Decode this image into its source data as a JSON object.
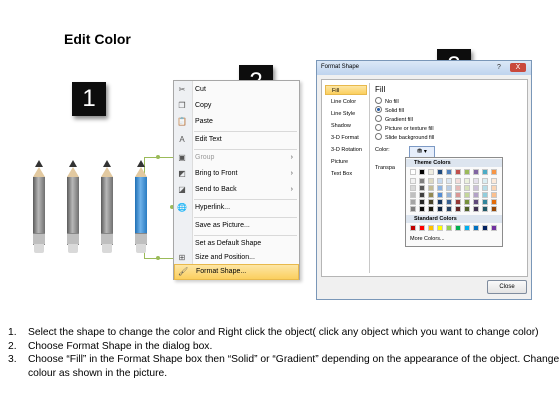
{
  "title": "Edit Color",
  "badges": [
    "1",
    "2",
    "3"
  ],
  "pencils": [
    {
      "color": "gray"
    },
    {
      "color": "gray"
    },
    {
      "color": "gray"
    },
    {
      "color": "blue",
      "hex": "#3a8fd6"
    }
  ],
  "context_menu": {
    "items": [
      {
        "label": "Cut",
        "icon": "scissors-icon",
        "enabled": true
      },
      {
        "label": "Copy",
        "icon": "copy-icon",
        "enabled": true
      },
      {
        "label": "Paste",
        "icon": "paste-icon",
        "enabled": true
      },
      {
        "label": "Edit Text",
        "icon": "edit-text-icon",
        "enabled": true
      },
      {
        "label": "Group",
        "icon": "group-icon",
        "enabled": false,
        "submenu": true
      },
      {
        "label": "Bring to Front",
        "icon": "bring-front-icon",
        "enabled": true,
        "submenu": true
      },
      {
        "label": "Send to Back",
        "icon": "send-back-icon",
        "enabled": true,
        "submenu": true
      },
      {
        "label": "Hyperlink...",
        "icon": "hyperlink-icon",
        "enabled": true
      },
      {
        "label": "Save as Picture...",
        "enabled": true
      },
      {
        "label": "Set as Default Shape",
        "enabled": true
      },
      {
        "label": "Size and Position...",
        "icon": "size-position-icon",
        "enabled": true
      },
      {
        "label": "Format Shape...",
        "icon": "format-shape-icon",
        "enabled": true,
        "highlighted": true
      }
    ]
  },
  "dialog": {
    "title": "Format Shape",
    "help": "?",
    "close_x": "X",
    "nav": [
      "Fill",
      "Line Color",
      "Line Style",
      "Shadow",
      "3-D Format",
      "3-D Rotation",
      "Picture",
      "Text Box"
    ],
    "section_title": "Fill",
    "options": [
      {
        "label": "No fill",
        "checked": false
      },
      {
        "label": "Solid fill",
        "checked": true
      },
      {
        "label": "Gradient fill",
        "checked": false
      },
      {
        "label": "Picture or texture fill",
        "checked": false
      },
      {
        "label": "Slide background fill",
        "checked": false
      }
    ],
    "color_label": "Color:",
    "transparency_label": "Transpa",
    "close_button": "Close",
    "picker": {
      "theme_header": "Theme Colors",
      "standard_header": "Standard Colors",
      "more_colors": "More Colors...",
      "theme_top": [
        "#ffffff",
        "#000000",
        "#eeece1",
        "#1f497d",
        "#4f81bd",
        "#c0504d",
        "#9bbb59",
        "#8064a2",
        "#4bacc6",
        "#f79646"
      ],
      "theme_shades": [
        [
          "#f2f2f2",
          "#7f7f7f",
          "#ddd9c3",
          "#c6d9f0",
          "#dbe5f1",
          "#f2dcdb",
          "#ebf1dd",
          "#e5e0ec",
          "#dbeef3",
          "#fdeada"
        ],
        [
          "#d8d8d8",
          "#595959",
          "#c4bd97",
          "#8db3e2",
          "#b8cce4",
          "#e5b9b7",
          "#d7e3bc",
          "#ccc1d9",
          "#b7dde8",
          "#fbd5b5"
        ],
        [
          "#bfbfbf",
          "#3f3f3f",
          "#938953",
          "#548dd4",
          "#95b3d7",
          "#d99694",
          "#c3d69b",
          "#b2a2c7",
          "#92cddc",
          "#fac08f"
        ],
        [
          "#a5a5a5",
          "#262626",
          "#494429",
          "#17365d",
          "#366092",
          "#953734",
          "#76923c",
          "#5f497a",
          "#31859b",
          "#e36c09"
        ],
        [
          "#7f7f7f",
          "#0c0c0c",
          "#1d1b10",
          "#0f243e",
          "#244061",
          "#632423",
          "#4f6128",
          "#3f3151",
          "#205867",
          "#974806"
        ]
      ],
      "standard": [
        "#c00000",
        "#ff0000",
        "#ffc000",
        "#ffff00",
        "#92d050",
        "#00b050",
        "#00b0f0",
        "#0070c0",
        "#002060",
        "#7030a0"
      ]
    }
  },
  "steps": [
    {
      "num": "1.",
      "text": "Select the shape to change the color and Right click the object( click any object which you want to change color)"
    },
    {
      "num": "2.",
      "text": "Choose Format Shape in the dialog box."
    },
    {
      "num": "3.",
      "text": "Choose “Fill” in the Format Shape box then “Solid” or “Gradient” depending on the appearance of the object. Change colour as shown in the picture."
    }
  ]
}
